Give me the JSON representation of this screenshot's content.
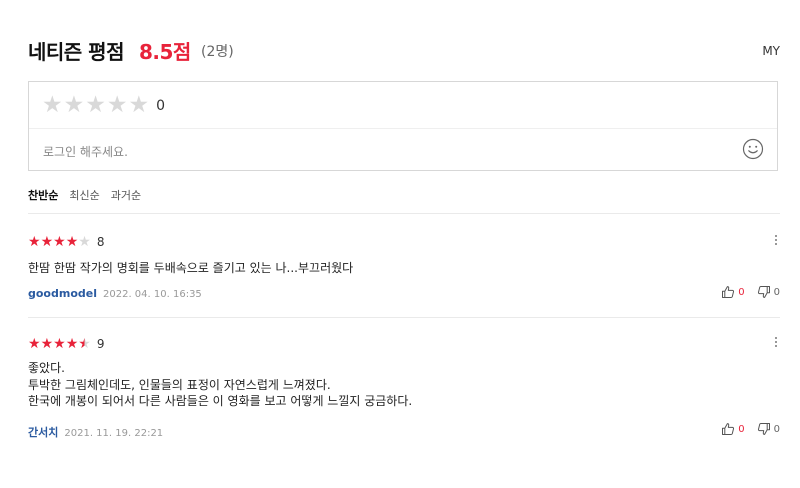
{
  "header": {
    "title": "네티즌 평점",
    "score": "8.5점",
    "count": "(2명)",
    "my_label": "MY"
  },
  "input": {
    "rating": "0",
    "placeholder": "로그인 해주세요.",
    "stars_total": 5
  },
  "sort": {
    "items": [
      "찬반순",
      "최신순",
      "과거순"
    ],
    "active": "찬반순"
  },
  "reviews": [
    {
      "stars": 4,
      "rating": "8",
      "text_lines": [
        "한땀 한땀 작가의 명회를 두배속으로 즐기고 있는 나...부끄러웠다"
      ],
      "author": "goodmodel",
      "date": "2022. 04. 10. 16:35",
      "likes": "0",
      "dislikes": "0"
    },
    {
      "stars": 4.5,
      "rating": "9",
      "text_lines": [
        "좋았다.",
        "투박한 그림체인데도, 인물들의 표정이 자연스럽게 느껴졌다.",
        "한국에 개봉이 되어서 다른 사람들은 이 영화를 보고 어떻게 느낄지 궁금하다."
      ],
      "author": "간서치",
      "date": "2021. 11. 19. 22:21",
      "likes": "0",
      "dislikes": "0"
    }
  ],
  "colors": {
    "accent": "#e8233a",
    "author": "#2a5aa0",
    "star_off": "#d9d9d9"
  },
  "icons": {
    "input_star": "star-icon",
    "emoji": "smile-icon",
    "like": "thumbs-up-icon",
    "dislike": "thumbs-down-icon",
    "more": "more-vertical-icon"
  }
}
